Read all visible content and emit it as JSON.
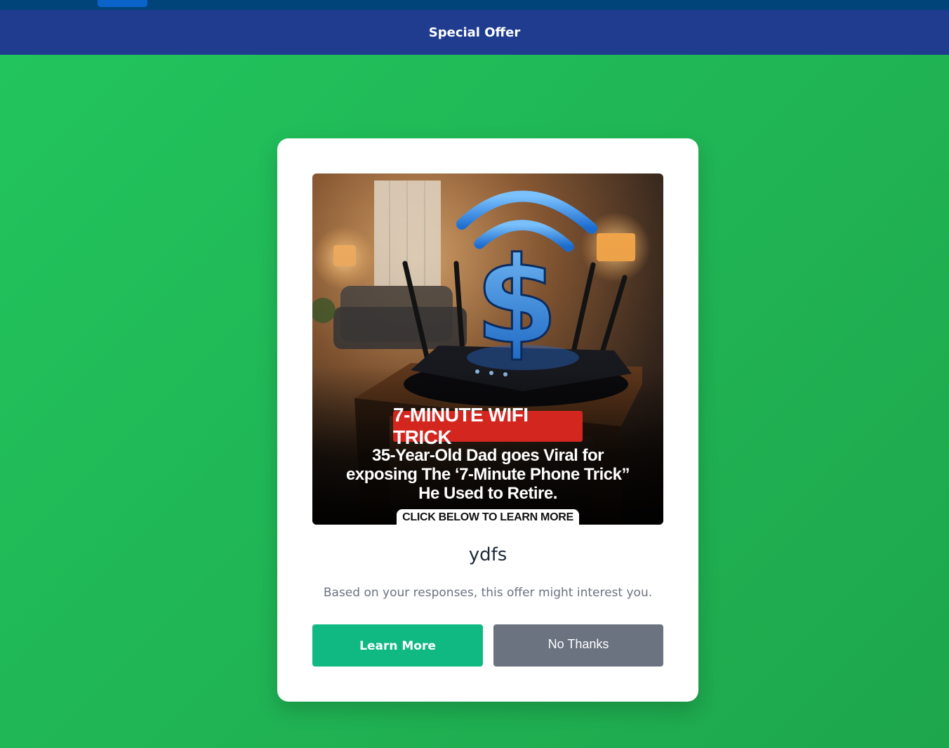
{
  "header": {
    "title": "Special Offer"
  },
  "ad": {
    "banner": "7-MINUTE WIFI TRICK",
    "headline_lines": [
      "35-Year-Old Dad goes Viral for",
      "exposing The ‘7-Minute Phone Trick”",
      "He Used to Retire."
    ],
    "cta": "CLICK BELOW TO LEARN MORE",
    "icon": "wifi-dollar-icon"
  },
  "offer": {
    "title": "ydfs",
    "description": "Based on your responses, this offer might interest you."
  },
  "buttons": {
    "learn_more": "Learn More",
    "no_thanks": "No Thanks"
  },
  "colors": {
    "background": "#22c55e",
    "top_bar": "#1f3c8f",
    "learn_more": "#10b981",
    "no_thanks": "#6b7280",
    "banner": "#d3261f"
  }
}
